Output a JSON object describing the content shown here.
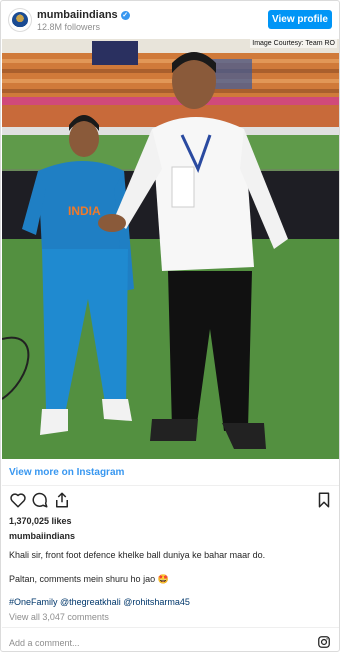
{
  "header": {
    "username": "mumbaiindians",
    "followers": "12.8M followers",
    "view_profile_label": "View profile"
  },
  "photo": {
    "credit": "Image Courtesy: Team RO",
    "jersey_text": "INDIA"
  },
  "post": {
    "view_more_label": "View more on Instagram",
    "likes": "1,370,025 likes",
    "caption_user": "mumbaiindians",
    "caption_line1": "Khali sir, front foot defence khelke ball duniya ke bahar maar do.",
    "caption_line2": "Paltan, comments mein shuru ho jao 🤩",
    "hashtags": "#OneFamily @thegreatkhali @rohitsharma45",
    "view_comments": "View all 3,047 comments",
    "add_comment_placeholder": "Add a comment..."
  },
  "icons": {
    "like": "heart-icon",
    "comment": "comment-icon",
    "share": "share-icon",
    "save": "bookmark-icon",
    "instagram": "instagram-icon",
    "verified": "verified-badge-icon"
  },
  "colors": {
    "accent": "#0095f6",
    "link": "#3897f0",
    "hashtag": "#00376b",
    "muted": "#8e8e8e"
  }
}
